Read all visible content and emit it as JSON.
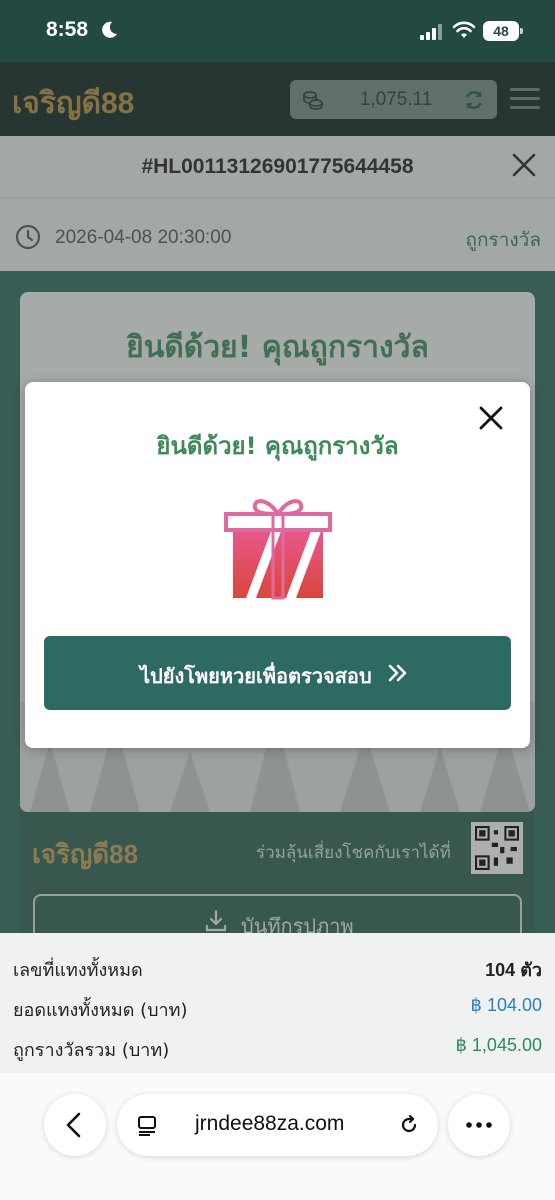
{
  "status_bar": {
    "time": "8:58",
    "battery": "48"
  },
  "app_header": {
    "logo": "เจริญดี88",
    "balance": "1,075.11"
  },
  "ticket": {
    "id": "#HL0011312690177564445​8",
    "datetime": "2026-04-08 20:30:00",
    "status": "ถูกรางวัล"
  },
  "background_card": {
    "title": "ยินดีด้วย! คุณถูกรางวัล",
    "footer_logo": "เจริญดี88",
    "footer_tagline": "ร่วมลุ้นเสี่ยงโชคกับเราได้ที่",
    "save_button": "บันทึกรูปภาพ"
  },
  "modal": {
    "title": "ยินดีด้วย! คุณถูกรางวัล",
    "cta_label": "ไปยังโพยหวยเพื่อตรวจสอบ",
    "gift_colors": {
      "outline": "#e06aa0",
      "fill_top": "#e8578a",
      "fill_bottom": "#d9463c"
    }
  },
  "summary": {
    "rows": [
      {
        "label": "เลขที่แทงทั้งหมด",
        "value": "104 ตัว"
      },
      {
        "label": "ยอดแทงทั้งหมด (บาท)",
        "value": "฿ 104.00"
      },
      {
        "label": "ถูกรางวัลรวม (บาท)",
        "value": "฿ 1,045.00"
      }
    ]
  },
  "browser": {
    "url": "jrndee88za.com"
  },
  "colors": {
    "primary": "#2d6a62",
    "accent_green": "#3e8a5a",
    "gold": "#b69042"
  }
}
